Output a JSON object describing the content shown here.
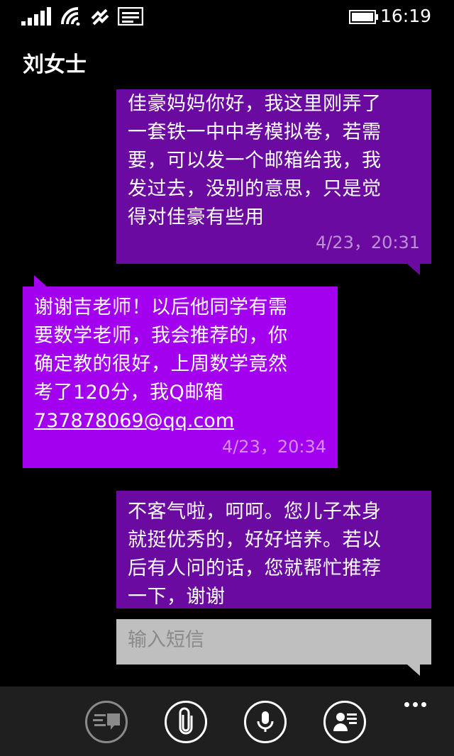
{
  "status_bar": {
    "time": "16:19",
    "icons": [
      "signal-bars-icon",
      "wifi-icon",
      "data-sense-icon",
      "message-icon",
      "battery-icon"
    ]
  },
  "contact": {
    "name": "刘女士"
  },
  "colors": {
    "outgoing": "#6b0aa0",
    "incoming": "#a300f0",
    "input": "#bfbfbf",
    "app_bar": "#1f1f1f"
  },
  "messages": [
    {
      "direction": "outgoing",
      "text": "佳豪妈妈你好，我这里刚弄了\n一套铁一中中考模拟卷，若需\n要，可以发一个邮箱给我，我\n发过去，没别的意思，只是觉\n得对佳豪有些用",
      "time": "4/23，20:31"
    },
    {
      "direction": "incoming",
      "text": "谢谢吉老师！以后他同学有需\n要数学老师，我会推荐的，你\n确定教的很好，上周数学竟然\n考了120分，我Q邮箱",
      "email": "737878069@qq.com",
      "time": "4/23，20:34"
    },
    {
      "direction": "outgoing",
      "text": "不客气啦，呵呵。您儿子本身\n就挺优秀的，好好培养。若以\n后有人问的话，您就帮忙推荐\n一下，谢谢",
      "time": ""
    }
  ],
  "compose": {
    "placeholder": "输入短信"
  },
  "app_bar": {
    "buttons": [
      "switch-icon",
      "attach-icon",
      "microphone-icon",
      "contact-card-icon"
    ],
    "more": "more-icon"
  }
}
